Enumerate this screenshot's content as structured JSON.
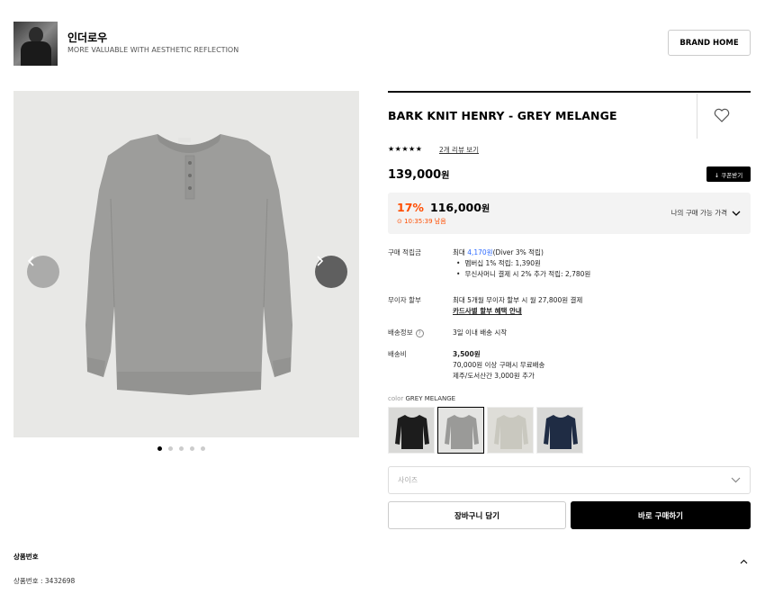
{
  "brand": {
    "name": "인더로우",
    "slogan": "MORE VALUABLE WITH AESTHETIC REFLECTION",
    "home_button": "BRAND HOME"
  },
  "gallery": {
    "image_count": 5,
    "active_index": 0
  },
  "product": {
    "title": "BARK KNIT HENRY - GREY MELANGE",
    "stars": "★★★★★",
    "review_link": "2개 리뷰 보기",
    "price": "139,000",
    "price_unit": "원",
    "coupon_button": "↓ 쿠폰받기"
  },
  "sale": {
    "rate": "17%",
    "price": "116,000",
    "unit": "원",
    "timer": "⊙ 10:35:39 남음",
    "my_price_label": "나의 구매 가능 가격"
  },
  "info": {
    "points_label": "구매 적립금",
    "points_prefix": "최대 ",
    "points_value": "4,170원",
    "points_suffix": "(Diver 3% 적립)",
    "points_items": [
      "멤버십 1% 적립: 1,390원",
      "무신사머니 결제 시 2% 추가 적립: 2,780원"
    ],
    "installment_label": "무이자 할부",
    "installment_text": "최대 5개월 무이자 할부 시 월 27,800원 결제",
    "installment_link": "카드사별 할부 혜택 안내",
    "shipping_info_label": "배송정보",
    "shipping_info_help": "?",
    "shipping_info_text": "3일 이내 배송 시작",
    "shipping_fee_label": "배송비",
    "shipping_fee_value": "3,500원",
    "shipping_fee_note1": "70,000원 이상 구매시 무료배송",
    "shipping_fee_note2": "제주/도서산간 3,000원 추가"
  },
  "color": {
    "label": "color",
    "selected": "GREY MELANGE",
    "swatches": [
      {
        "name": "black",
        "color": "#1c1c1c",
        "bg": "#d9d9d7"
      },
      {
        "name": "grey-melange",
        "color": "#9a9a98",
        "bg": "#e4e4e2"
      },
      {
        "name": "oatmeal",
        "color": "#c9c8bf",
        "bg": "#deddd8"
      },
      {
        "name": "navy",
        "color": "#1f2c44",
        "bg": "#d8d8d6"
      }
    ]
  },
  "size_placeholder": "사이즈",
  "actions": {
    "cart": "장바구니 담기",
    "buy": "바로 구매하기"
  },
  "product_number": {
    "title": "상품번호",
    "text": "상품번호 : 3432698"
  },
  "colors": {
    "sale_accent": "#ff4d00",
    "points_blue": "#2e6bff",
    "sweater": "#9d9d9b",
    "gallery_bg": "#e8e8e6"
  }
}
